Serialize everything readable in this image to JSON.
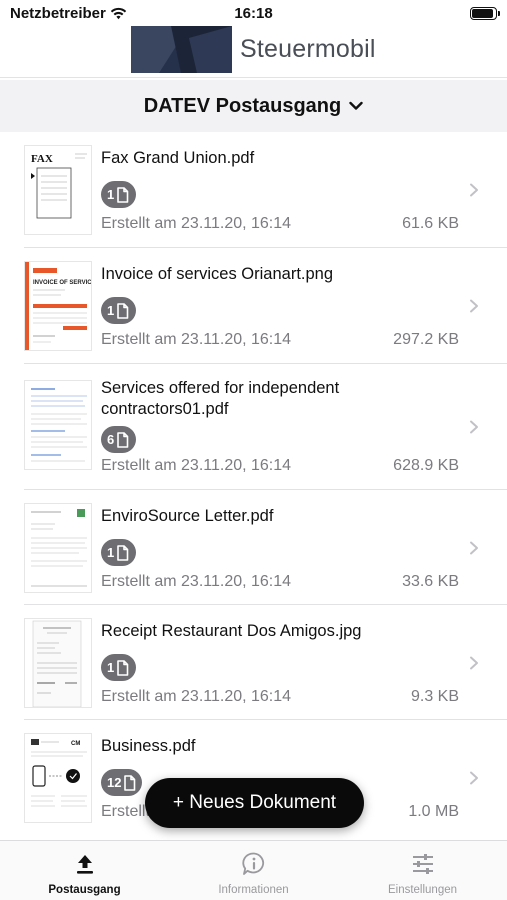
{
  "status_bar": {
    "carrier": "Netzbetreiber",
    "time": "16:18",
    "battery_level": 0.9
  },
  "header": {
    "brand": "Steuermobil"
  },
  "folder": {
    "title": "DATEV Postausgang",
    "icon": "chevron-down-icon"
  },
  "documents": [
    {
      "name": "Fax Grand Union.pdf",
      "pages": "1",
      "created": "Erstellt am 23.11.20, 16:14",
      "size": "61.6 KB"
    },
    {
      "name": "Invoice of services Orianart.png",
      "pages": "1",
      "created": "Erstellt am 23.11.20, 16:14",
      "size": "297.2 KB"
    },
    {
      "name": "Services offered for independent contractors01.pdf",
      "pages": "6",
      "created": "Erstellt am 23.11.20, 16:14",
      "size": "628.9 KB"
    },
    {
      "name": "EnviroSource Letter.pdf",
      "pages": "1",
      "created": "Erstellt am 23.11.20, 16:14",
      "size": "33.6 KB"
    },
    {
      "name": "Receipt Restaurant Dos Amigos.jpg",
      "pages": "1",
      "created": "Erstellt am 23.11.20, 16:14",
      "size": "9.3 KB"
    },
    {
      "name": "Business.pdf",
      "pages": "12",
      "created": "Erstellt am 23.11.20, 16:14",
      "size": "1.0 MB"
    }
  ],
  "fab": {
    "label": "+ Neues Dokument"
  },
  "tabs": [
    {
      "label": "Postausgang",
      "icon": "upload-icon",
      "active": true
    },
    {
      "label": "Informationen",
      "icon": "info-icon",
      "active": false
    },
    {
      "label": "Einstellungen",
      "icon": "sliders-icon",
      "active": false
    }
  ],
  "colors": {
    "badge": "#6e6e72",
    "fab": "#0a0a0a",
    "separator": "#e2e2e4",
    "muted_text": "#7b7b80",
    "orange_accent": "#e8572a"
  }
}
